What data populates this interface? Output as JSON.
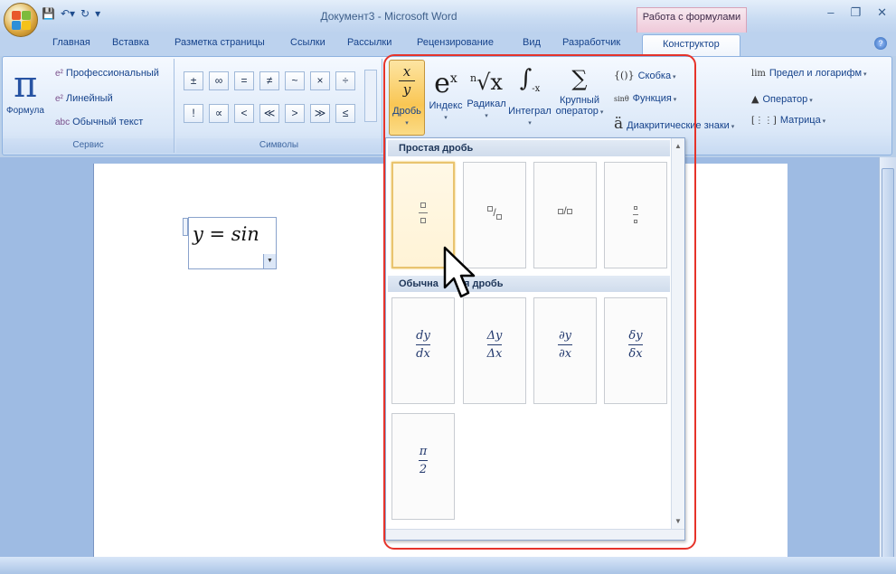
{
  "window": {
    "title": "Документ3 - Microsoft Word",
    "context_header": "Работа с формулами",
    "controls": [
      "–",
      "❐",
      "✕"
    ]
  },
  "tabs": [
    "Главная",
    "Вставка",
    "Разметка страницы",
    "Ссылки",
    "Рассылки",
    "Рецензирование",
    "Вид",
    "Разработчик",
    "Конструктор"
  ],
  "active_tab": "Конструктор",
  "ribbon": {
    "service": {
      "label": "Сервис",
      "formula": "Формула",
      "items": [
        "Профессиональный",
        "Линейный",
        "Обычный текст"
      ]
    },
    "symbols": {
      "label": "Символы",
      "row1": [
        "±",
        "∞",
        "=",
        "≠",
        "~",
        "×",
        "÷"
      ],
      "row2": [
        "!",
        "∝",
        "<",
        "≪",
        ">",
        "≫",
        "≤"
      ]
    },
    "structures": {
      "fraction": "Дробь",
      "index": "Индекс",
      "radical": "Радикал",
      "integral": "Интеграл",
      "large_op_1": "Крупный",
      "large_op_2": "оператор",
      "bracket": "Скобка",
      "function": "Функция",
      "accent": "Диакритические знаки",
      "limit": "Предел и логарифм",
      "operator": "Оператор",
      "matrix": "Матрица"
    }
  },
  "document": {
    "equation": "y = sin"
  },
  "gallery": {
    "section1": "Простая дробь",
    "section2": "Обычная дробь",
    "section2_visible_left": "Обычна",
    "section2_visible_right": "ая дробь",
    "common": [
      {
        "num": "dy",
        "den": "dx"
      },
      {
        "num": "Δy",
        "den": "Δx"
      },
      {
        "num": "∂y",
        "den": "∂x"
      },
      {
        "num": "δy",
        "den": "δx"
      },
      {
        "num": "π",
        "den": "2"
      }
    ]
  }
}
